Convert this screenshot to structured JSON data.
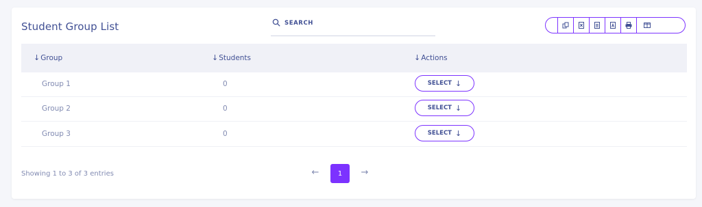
{
  "card": {
    "title": "Student Group List"
  },
  "search": {
    "placeholder": "SEARCH",
    "icon": "search-icon"
  },
  "toolbar": {
    "buttons": [
      {
        "name": "copy",
        "icon": "copy-icon"
      },
      {
        "name": "excel",
        "icon": "excel-file-icon"
      },
      {
        "name": "csv",
        "icon": "csv-file-icon"
      },
      {
        "name": "pdf",
        "icon": "pdf-file-icon"
      },
      {
        "name": "print",
        "icon": "print-icon"
      },
      {
        "name": "columns",
        "icon": "columns-icon"
      }
    ]
  },
  "table": {
    "sort_arrow": "↓",
    "headers": {
      "group": "Group",
      "students": "Students",
      "actions": "Actions"
    },
    "rows": [
      {
        "group": "Group 1",
        "students": "0",
        "action": "SELECT"
      },
      {
        "group": "Group 2",
        "students": "0",
        "action": "SELECT"
      },
      {
        "group": "Group 3",
        "students": "0",
        "action": "SELECT"
      }
    ],
    "action_arrow": "↓"
  },
  "footer": {
    "info": "Showing 1 to 3 of 3 entries",
    "prev": "←",
    "page": "1",
    "next": "→"
  },
  "colors": {
    "accent": "#7c32ff",
    "text": "#415094",
    "muted": "#828bb2"
  }
}
